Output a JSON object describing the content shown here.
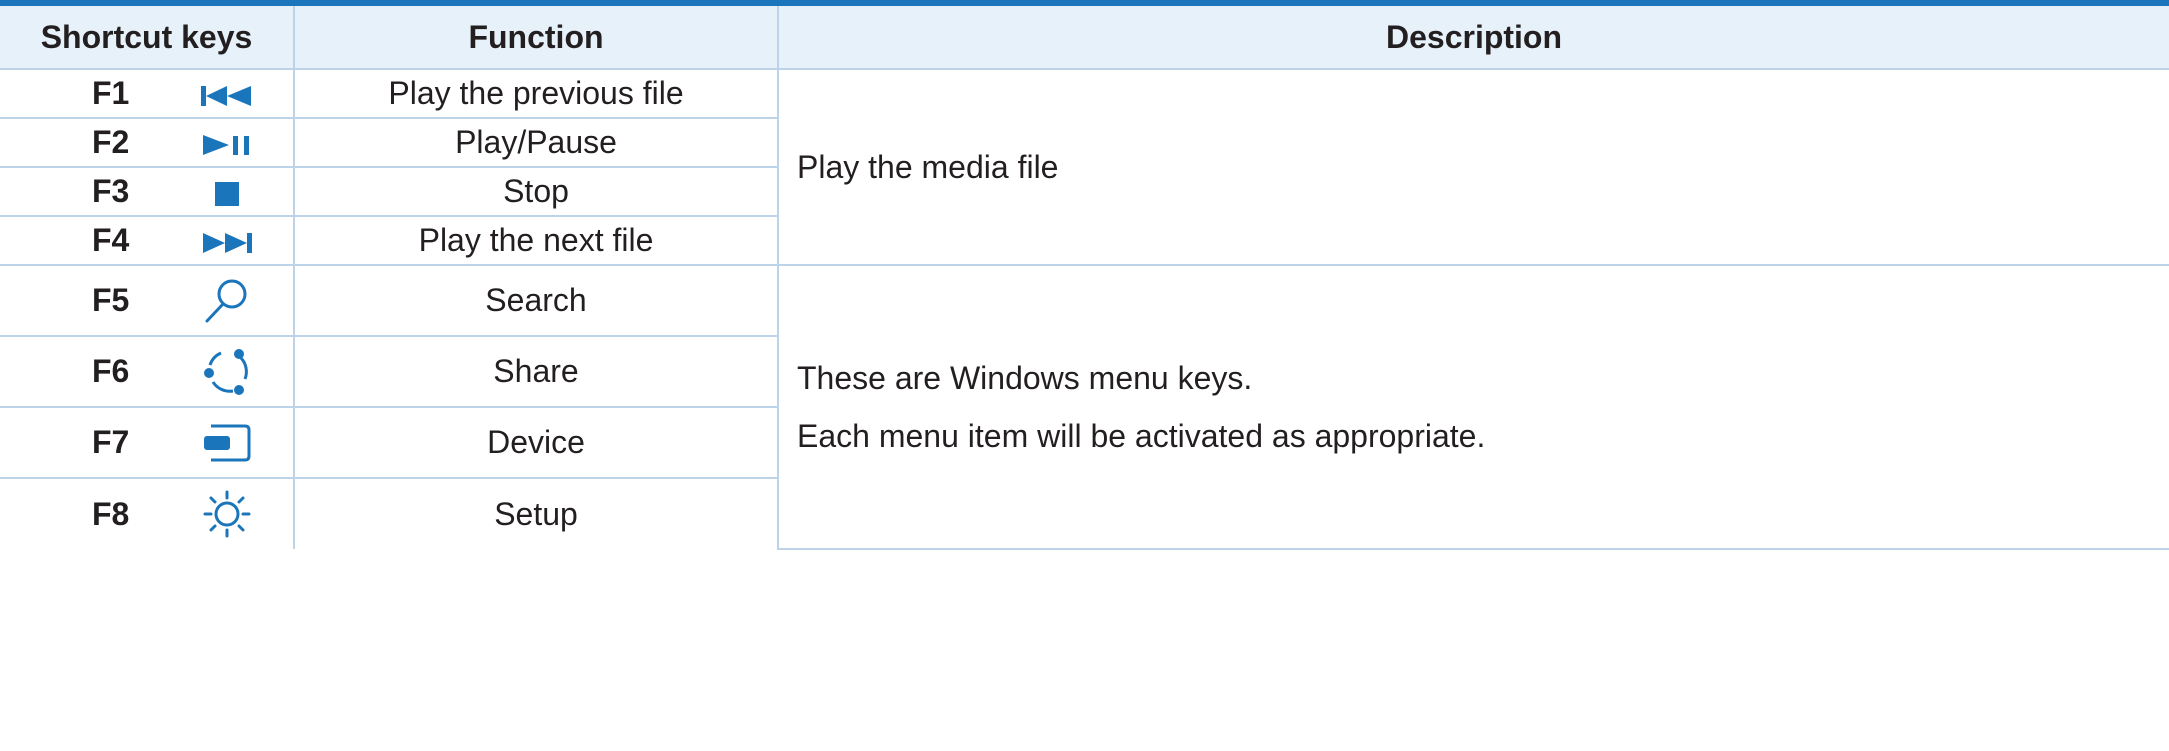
{
  "colors": {
    "accent": "#1b75bb",
    "header_bg": "#e6f1fa",
    "border": "#bcd3e8"
  },
  "header": {
    "shortcut_keys": "Shortcut keys",
    "function": "Function",
    "description": "Description"
  },
  "rows": [
    {
      "key": "F1",
      "icon": "previous-track-icon",
      "function": "Play the previous file"
    },
    {
      "key": "F2",
      "icon": "play-pause-icon",
      "function": "Play/Pause"
    },
    {
      "key": "F3",
      "icon": "stop-icon",
      "function": "Stop"
    },
    {
      "key": "F4",
      "icon": "next-track-icon",
      "function": "Play the next file"
    },
    {
      "key": "F5",
      "icon": "search-icon",
      "function": "Search"
    },
    {
      "key": "F6",
      "icon": "share-icon",
      "function": "Share"
    },
    {
      "key": "F7",
      "icon": "device-icon",
      "function": "Device"
    },
    {
      "key": "F8",
      "icon": "setup-sun-icon",
      "function": "Setup"
    }
  ],
  "descriptions": {
    "media": "Play the media file",
    "windows_line1": "These are Windows menu keys.",
    "windows_line2": "Each menu item will be activated as appropriate."
  }
}
